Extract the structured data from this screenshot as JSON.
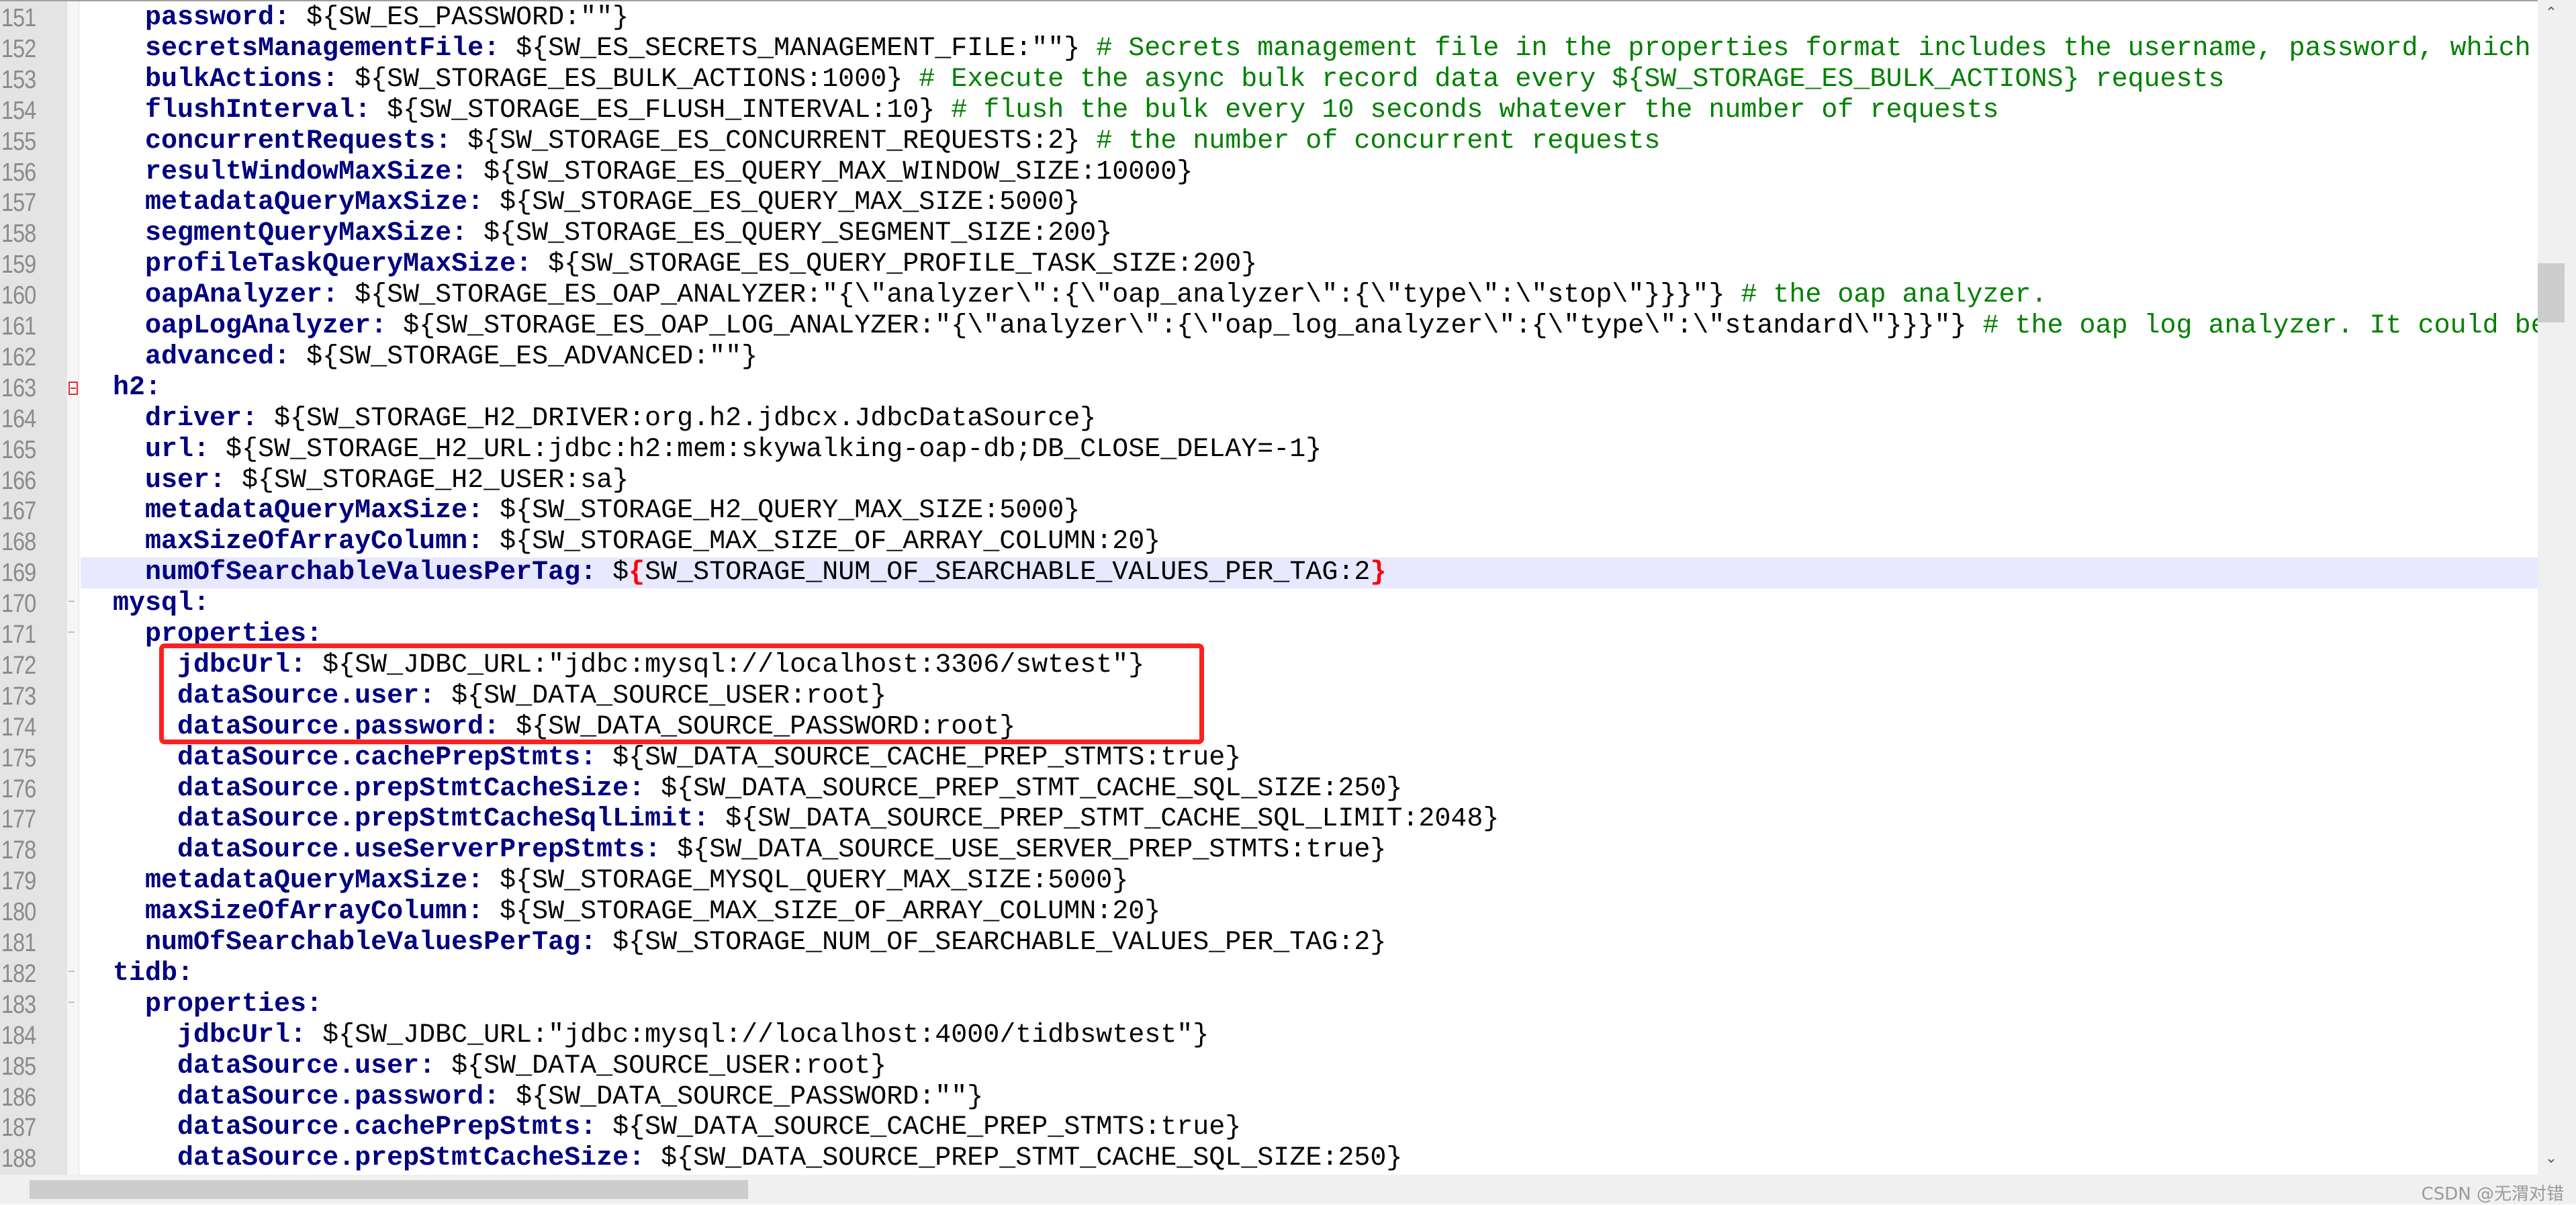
{
  "editor": {
    "current_line": 169,
    "colors": {
      "key": "#000080",
      "value": "#000000",
      "comment": "#008000",
      "brace_match": "#ff0000",
      "current_line_bg": "#e8e8ff",
      "highlight_box": "#ff2020"
    },
    "highlight_box_lines": [
      172,
      174
    ],
    "lines": [
      {
        "num": "151",
        "indent": "    ",
        "segs": [
          {
            "t": "password:",
            "s": "k"
          },
          {
            "t": " ${SW_ES_PASSWORD:\"\"}",
            "s": "v"
          }
        ]
      },
      {
        "num": "152",
        "indent": "    ",
        "segs": [
          {
            "t": "secretsManagementFile:",
            "s": "k"
          },
          {
            "t": " ${SW_ES_SECRETS_MANAGEMENT_FILE:\"\"} ",
            "s": "v"
          },
          {
            "t": "# Secrets management file in the properties format includes the username, password, which",
            "s": "c"
          }
        ]
      },
      {
        "num": "153",
        "indent": "    ",
        "segs": [
          {
            "t": "bulkActions:",
            "s": "k"
          },
          {
            "t": " ${SW_STORAGE_ES_BULK_ACTIONS:1000} ",
            "s": "v"
          },
          {
            "t": "# Execute the async bulk record data every ${SW_STORAGE_ES_BULK_ACTIONS} requests",
            "s": "c"
          }
        ]
      },
      {
        "num": "154",
        "indent": "    ",
        "segs": [
          {
            "t": "flushInterval:",
            "s": "k"
          },
          {
            "t": " ${SW_STORAGE_ES_FLUSH_INTERVAL:10} ",
            "s": "v"
          },
          {
            "t": "# flush the bulk every 10 seconds whatever the number of requests",
            "s": "c"
          }
        ]
      },
      {
        "num": "155",
        "indent": "    ",
        "segs": [
          {
            "t": "concurrentRequests:",
            "s": "k"
          },
          {
            "t": " ${SW_STORAGE_ES_CONCURRENT_REQUESTS:2} ",
            "s": "v"
          },
          {
            "t": "# the number of concurrent requests",
            "s": "c"
          }
        ]
      },
      {
        "num": "156",
        "indent": "    ",
        "segs": [
          {
            "t": "resultWindowMaxSize:",
            "s": "k"
          },
          {
            "t": " ${SW_STORAGE_ES_QUERY_MAX_WINDOW_SIZE:10000}",
            "s": "v"
          }
        ]
      },
      {
        "num": "157",
        "indent": "    ",
        "segs": [
          {
            "t": "metadataQueryMaxSize:",
            "s": "k"
          },
          {
            "t": " ${SW_STORAGE_ES_QUERY_MAX_SIZE:5000}",
            "s": "v"
          }
        ]
      },
      {
        "num": "158",
        "indent": "    ",
        "segs": [
          {
            "t": "segmentQueryMaxSize:",
            "s": "k"
          },
          {
            "t": " ${SW_STORAGE_ES_QUERY_SEGMENT_SIZE:200}",
            "s": "v"
          }
        ]
      },
      {
        "num": "159",
        "indent": "    ",
        "segs": [
          {
            "t": "profileTaskQueryMaxSize:",
            "s": "k"
          },
          {
            "t": " ${SW_STORAGE_ES_QUERY_PROFILE_TASK_SIZE:200}",
            "s": "v"
          }
        ]
      },
      {
        "num": "160",
        "indent": "    ",
        "segs": [
          {
            "t": "oapAnalyzer:",
            "s": "k"
          },
          {
            "t": " ${SW_STORAGE_ES_OAP_ANALYZER:\"{\\\"analyzer\\\":{\\\"oap_analyzer\\\":{\\\"type\\\":\\\"stop\\\"}}}\"} ",
            "s": "v"
          },
          {
            "t": "# the oap analyzer.",
            "s": "c"
          }
        ]
      },
      {
        "num": "161",
        "indent": "    ",
        "segs": [
          {
            "t": "oapLogAnalyzer:",
            "s": "k"
          },
          {
            "t": " ${SW_STORAGE_ES_OAP_LOG_ANALYZER:\"{\\\"analyzer\\\":{\\\"oap_log_analyzer\\\":{\\\"type\\\":\\\"standard\\\"}}}\"} ",
            "s": "v"
          },
          {
            "t": "# the oap log analyzer. It could be",
            "s": "c"
          }
        ]
      },
      {
        "num": "162",
        "indent": "    ",
        "segs": [
          {
            "t": "advanced:",
            "s": "k"
          },
          {
            "t": " ${SW_STORAGE_ES_ADVANCED:\"\"}",
            "s": "v"
          }
        ]
      },
      {
        "num": "163",
        "indent": "  ",
        "fold": "box",
        "segs": [
          {
            "t": "h2:",
            "s": "k"
          }
        ]
      },
      {
        "num": "164",
        "indent": "    ",
        "segs": [
          {
            "t": "driver:",
            "s": "k"
          },
          {
            "t": " ${SW_STORAGE_H2_DRIVER:org.h2.jdbcx.JdbcDataSource}",
            "s": "v"
          }
        ]
      },
      {
        "num": "165",
        "indent": "    ",
        "segs": [
          {
            "t": "url:",
            "s": "k"
          },
          {
            "t": " ${SW_STORAGE_H2_URL:jdbc:h2:mem:skywalking-oap-db;DB_CLOSE_DELAY=-1}",
            "s": "v"
          }
        ]
      },
      {
        "num": "166",
        "indent": "    ",
        "segs": [
          {
            "t": "user:",
            "s": "k"
          },
          {
            "t": " ${SW_STORAGE_H2_USER:sa}",
            "s": "v"
          }
        ]
      },
      {
        "num": "167",
        "indent": "    ",
        "segs": [
          {
            "t": "metadataQueryMaxSize:",
            "s": "k"
          },
          {
            "t": " ${SW_STORAGE_H2_QUERY_MAX_SIZE:5000}",
            "s": "v"
          }
        ]
      },
      {
        "num": "168",
        "indent": "    ",
        "segs": [
          {
            "t": "maxSizeOfArrayColumn:",
            "s": "k"
          },
          {
            "t": " ${SW_STORAGE_MAX_SIZE_OF_ARRAY_COLUMN:20}",
            "s": "v"
          }
        ]
      },
      {
        "num": "169",
        "indent": "    ",
        "segs": [
          {
            "t": "numOfSearchableValuesPerTag:",
            "s": "k"
          },
          {
            "t": " $",
            "s": "v"
          },
          {
            "t": "{",
            "s": "brace"
          },
          {
            "t": "SW_STORAGE_NUM_OF_SEARCHABLE_VALUES_PER_TAG:2",
            "s": "v"
          },
          {
            "t": "}",
            "s": "brace"
          }
        ]
      },
      {
        "num": "170",
        "indent": "  ",
        "fold": "line",
        "segs": [
          {
            "t": "mysql:",
            "s": "k"
          }
        ]
      },
      {
        "num": "171",
        "indent": "    ",
        "fold": "line",
        "segs": [
          {
            "t": "properties:",
            "s": "k"
          }
        ]
      },
      {
        "num": "172",
        "indent": "      ",
        "segs": [
          {
            "t": "jdbcUrl:",
            "s": "k"
          },
          {
            "t": " ${SW_JDBC_URL:\"jdbc:mysql://localhost:3306/swtest\"}",
            "s": "v"
          }
        ]
      },
      {
        "num": "173",
        "indent": "      ",
        "segs": [
          {
            "t": "dataSource.user:",
            "s": "k"
          },
          {
            "t": " ${SW_DATA_SOURCE_USER:root}",
            "s": "v"
          }
        ]
      },
      {
        "num": "174",
        "indent": "      ",
        "segs": [
          {
            "t": "dataSource.password:",
            "s": "k"
          },
          {
            "t": " ${SW_DATA_SOURCE_PASSWORD:root}",
            "s": "v"
          }
        ]
      },
      {
        "num": "175",
        "indent": "      ",
        "segs": [
          {
            "t": "dataSource.cachePrepStmts:",
            "s": "k"
          },
          {
            "t": " ${SW_DATA_SOURCE_CACHE_PREP_STMTS:true}",
            "s": "v"
          }
        ]
      },
      {
        "num": "176",
        "indent": "      ",
        "segs": [
          {
            "t": "dataSource.prepStmtCacheSize:",
            "s": "k"
          },
          {
            "t": " ${SW_DATA_SOURCE_PREP_STMT_CACHE_SQL_SIZE:250}",
            "s": "v"
          }
        ]
      },
      {
        "num": "177",
        "indent": "      ",
        "segs": [
          {
            "t": "dataSource.prepStmtCacheSqlLimit:",
            "s": "k"
          },
          {
            "t": " ${SW_DATA_SOURCE_PREP_STMT_CACHE_SQL_LIMIT:2048}",
            "s": "v"
          }
        ]
      },
      {
        "num": "178",
        "indent": "      ",
        "segs": [
          {
            "t": "dataSource.useServerPrepStmts:",
            "s": "k"
          },
          {
            "t": " ${SW_DATA_SOURCE_USE_SERVER_PREP_STMTS:true}",
            "s": "v"
          }
        ]
      },
      {
        "num": "179",
        "indent": "    ",
        "segs": [
          {
            "t": "metadataQueryMaxSize:",
            "s": "k"
          },
          {
            "t": " ${SW_STORAGE_MYSQL_QUERY_MAX_SIZE:5000}",
            "s": "v"
          }
        ]
      },
      {
        "num": "180",
        "indent": "    ",
        "segs": [
          {
            "t": "maxSizeOfArrayColumn:",
            "s": "k"
          },
          {
            "t": " ${SW_STORAGE_MAX_SIZE_OF_ARRAY_COLUMN:20}",
            "s": "v"
          }
        ]
      },
      {
        "num": "181",
        "indent": "    ",
        "segs": [
          {
            "t": "numOfSearchableValuesPerTag:",
            "s": "k"
          },
          {
            "t": " ${SW_STORAGE_NUM_OF_SEARCHABLE_VALUES_PER_TAG:2}",
            "s": "v"
          }
        ]
      },
      {
        "num": "182",
        "indent": "  ",
        "fold": "line",
        "segs": [
          {
            "t": "tidb:",
            "s": "k"
          }
        ]
      },
      {
        "num": "183",
        "indent": "    ",
        "fold": "line",
        "segs": [
          {
            "t": "properties:",
            "s": "k"
          }
        ]
      },
      {
        "num": "184",
        "indent": "      ",
        "segs": [
          {
            "t": "jdbcUrl:",
            "s": "k"
          },
          {
            "t": " ${SW_JDBC_URL:\"jdbc:mysql://localhost:4000/tidbswtest\"}",
            "s": "v"
          }
        ]
      },
      {
        "num": "185",
        "indent": "      ",
        "segs": [
          {
            "t": "dataSource.user:",
            "s": "k"
          },
          {
            "t": " ${SW_DATA_SOURCE_USER:root}",
            "s": "v"
          }
        ]
      },
      {
        "num": "186",
        "indent": "      ",
        "segs": [
          {
            "t": "dataSource.password:",
            "s": "k"
          },
          {
            "t": " ${SW_DATA_SOURCE_PASSWORD:\"\"}",
            "s": "v"
          }
        ]
      },
      {
        "num": "187",
        "indent": "      ",
        "segs": [
          {
            "t": "dataSource.cachePrepStmts:",
            "s": "k"
          },
          {
            "t": " ${SW_DATA_SOURCE_CACHE_PREP_STMTS:true}",
            "s": "v"
          }
        ]
      },
      {
        "num": "188",
        "indent": "      ",
        "segs": [
          {
            "t": "dataSource.prepStmtCacheSize:",
            "s": "k"
          },
          {
            "t": " ${SW_DATA_SOURCE_PREP_STMT_CACHE_SQL_SIZE:250}",
            "s": "v"
          }
        ]
      }
    ]
  },
  "scrollbars": {
    "up_icon": "chevron-up-icon",
    "down_icon": "chevron-down-icon"
  },
  "watermark": "CSDN @无渭对错"
}
